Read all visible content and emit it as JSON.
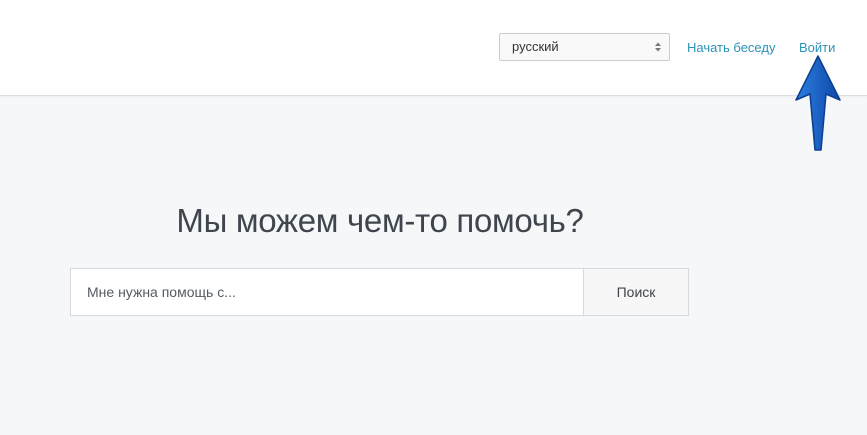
{
  "header": {
    "language_select": {
      "selected": "русский"
    },
    "links": {
      "start_chat": "Начать беседу",
      "login": "Войти"
    }
  },
  "main": {
    "title": "Мы можем чем-то помочь?",
    "search": {
      "placeholder": "Мне нужна помощь с...",
      "value": "",
      "button_label": "Поиск"
    }
  },
  "colors": {
    "link": "#2e91b8",
    "page_background": "#f6f7f9",
    "annotation_arrow": "#1a5fbf"
  }
}
